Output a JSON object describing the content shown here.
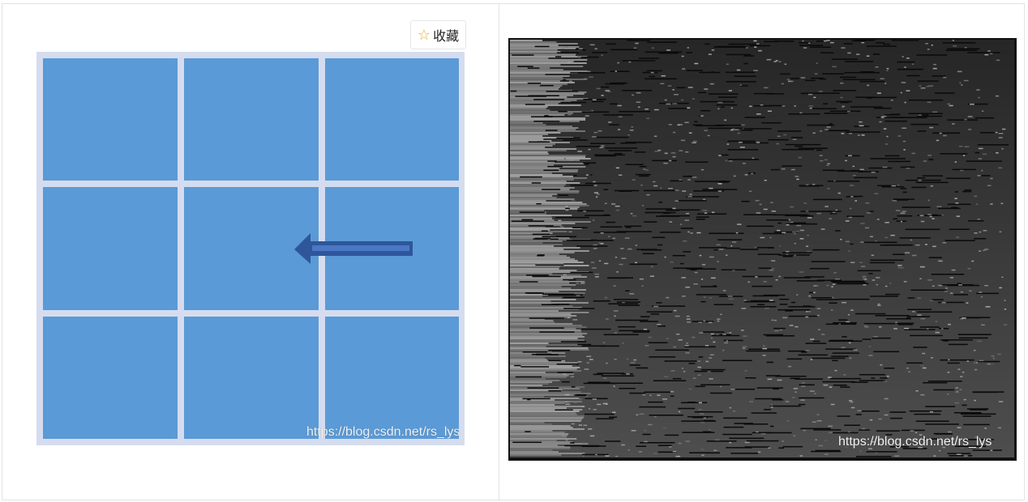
{
  "toolbar": {
    "collect_label": "收藏",
    "collect_icon": "star-outline-icon",
    "star_color": "#f5a623"
  },
  "left_figure": {
    "description_icon": "arrow-left-icon",
    "cell_color": "#5a9ad6",
    "frame_color": "#d5dcef",
    "arrow_color": "#2f569a",
    "watermark": "https://blog.csdn.net/rs_lys"
  },
  "right_figure": {
    "base_color": "#121212",
    "watermark": "https://blog.csdn.net/rs_lys"
  }
}
